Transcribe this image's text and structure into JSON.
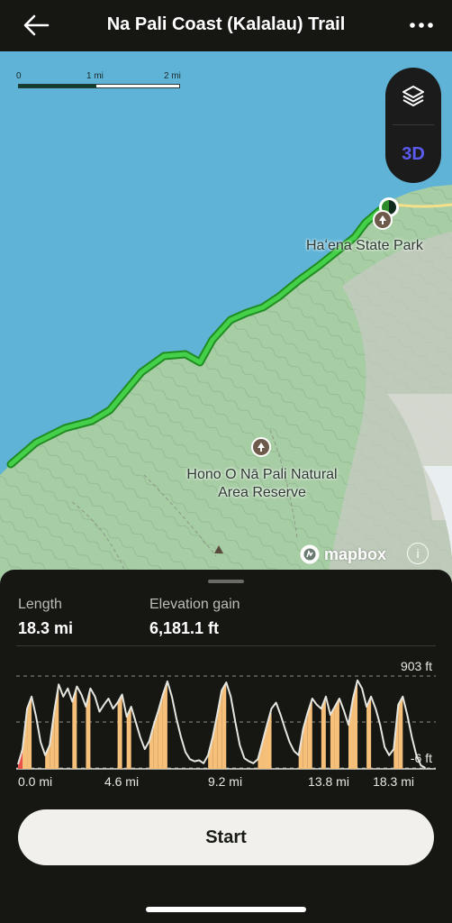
{
  "header": {
    "title": "Na Pali Coast (Kalalau) Trail",
    "back_icon": "arrow-left-icon",
    "more_icon": "more-horizontal-icon"
  },
  "map": {
    "scale": {
      "labels": [
        "0",
        "1 mi",
        "2 mi"
      ]
    },
    "layers_icon": "layers-icon",
    "view_3d_label": "3D",
    "places": [
      {
        "name": "Haʻena State Park",
        "icon": "tree-icon"
      },
      {
        "name": "Hono O Nā Pali Natural Area Reserve",
        "line1": "Hono O Nā Pali Natural",
        "line2": "Area Reserve",
        "icon": "tree-icon"
      }
    ],
    "attribution": "mapbox",
    "info_label": "i",
    "colors": {
      "water": "#5fb3d6",
      "land": "#a7cda4",
      "trail": "#36c23a"
    }
  },
  "sheet": {
    "length": {
      "label": "Length",
      "value": "18.3 mi"
    },
    "elevation": {
      "label": "Elevation gain",
      "value": "6,181.1 ft"
    },
    "start_label": "Start"
  },
  "chart_data": {
    "type": "area",
    "ylabel_ticks": [
      "903 ft",
      "-6 ft"
    ],
    "ylim": [
      -6,
      903
    ],
    "xlim": [
      0,
      18.3
    ],
    "x_tick_labels": [
      "0.0 mi",
      "4.6 mi",
      "9.2 mi",
      "13.8 mi",
      "18.3 mi"
    ],
    "colors": {
      "line": "#e6e6e0",
      "steep": "#e8524a",
      "climb": "#f6c07a",
      "grid": "#8f8f88"
    },
    "x": [
      0,
      0.2,
      0.4,
      0.6,
      0.8,
      1.0,
      1.2,
      1.4,
      1.6,
      1.8,
      2.0,
      2.2,
      2.4,
      2.6,
      2.8,
      3.0,
      3.2,
      3.4,
      3.6,
      3.8,
      4.0,
      4.2,
      4.4,
      4.6,
      4.8,
      5.0,
      5.2,
      5.4,
      5.6,
      5.8,
      6.0,
      6.2,
      6.4,
      6.6,
      6.8,
      7.0,
      7.2,
      7.4,
      7.6,
      7.8,
      8.0,
      8.2,
      8.4,
      8.6,
      8.8,
      9.0,
      9.2,
      9.4,
      9.6,
      9.8,
      10.0,
      10.2,
      10.4,
      10.6,
      10.8,
      11.0,
      11.2,
      11.4,
      11.6,
      11.8,
      12.0,
      12.2,
      12.4,
      12.6,
      12.8,
      13.0,
      13.2,
      13.4,
      13.6,
      13.8,
      14.0,
      14.2,
      14.4,
      14.6,
      14.8,
      15.0,
      15.2,
      15.4,
      15.6,
      15.8,
      16.0,
      16.2,
      16.4,
      16.6,
      16.8,
      17.0,
      17.2,
      17.4,
      17.6,
      17.8,
      18.0,
      18.3
    ],
    "values": [
      30,
      180,
      580,
      700,
      500,
      250,
      120,
      220,
      550,
      820,
      700,
      780,
      650,
      800,
      720,
      600,
      780,
      700,
      550,
      620,
      680,
      580,
      640,
      720,
      500,
      600,
      450,
      300,
      180,
      260,
      420,
      560,
      720,
      850,
      700,
      480,
      300,
      150,
      80,
      60,
      70,
      40,
      120,
      300,
      520,
      760,
      840,
      700,
      450,
      220,
      90,
      60,
      40,
      80,
      250,
      420,
      580,
      640,
      520,
      380,
      250,
      160,
      120,
      380,
      540,
      680,
      620,
      580,
      700,
      520,
      600,
      680,
      560,
      420,
      680,
      860,
      780,
      600,
      700,
      580,
      420,
      200,
      120,
      180,
      620,
      700,
      520,
      300,
      120,
      20,
      -6
    ]
  }
}
